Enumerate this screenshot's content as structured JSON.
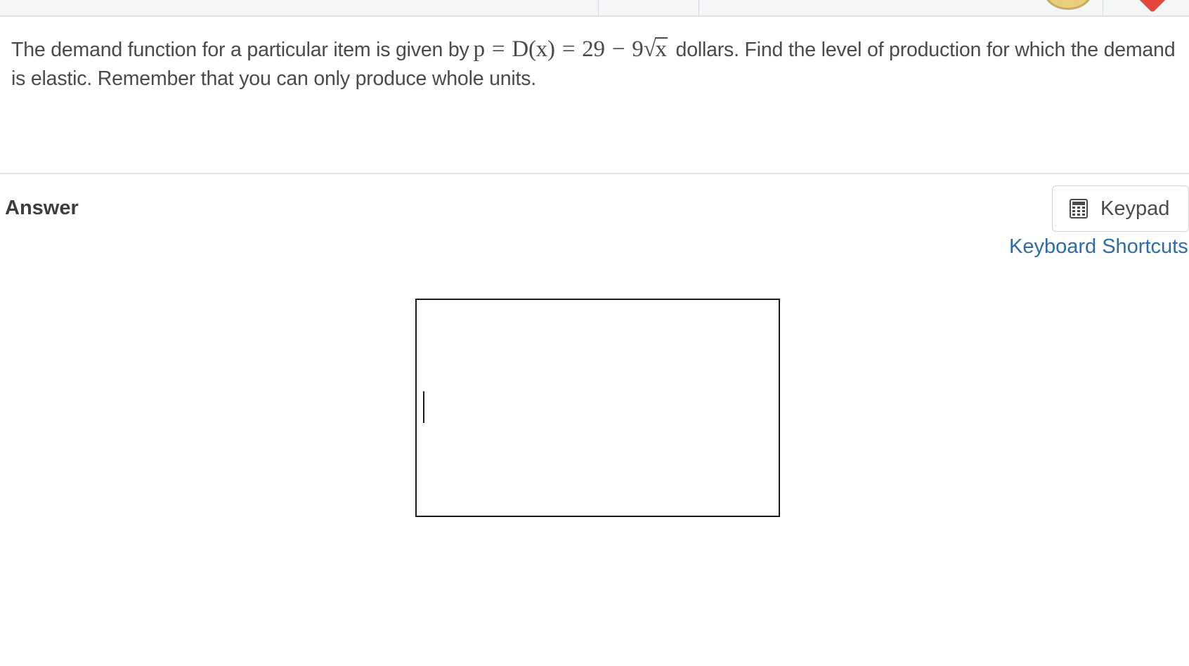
{
  "header": {
    "icons": [
      "coin-icon",
      "heart-icon"
    ]
  },
  "question": {
    "text_before": "The demand function for a particular item is given by",
    "math": {
      "p": "p",
      "eq1": "=",
      "func": "D(x)",
      "eq2": "=",
      "constant": "29",
      "minus": "−",
      "coefficient": "9",
      "radicand": "x"
    },
    "text_after": "dollars. Find the level of production for which the demand is elastic. Remember that you can only produce whole units."
  },
  "answer": {
    "label": "Answer",
    "keypad_label": "Keypad",
    "keypad_icon": "calculator-icon",
    "shortcuts_link": "Keyboard Shortcuts",
    "input_value": ""
  },
  "colors": {
    "link": "#2d6ca8",
    "text": "#4a4a4a",
    "coin": "#e9cf7d",
    "heart": "#e5473b"
  }
}
